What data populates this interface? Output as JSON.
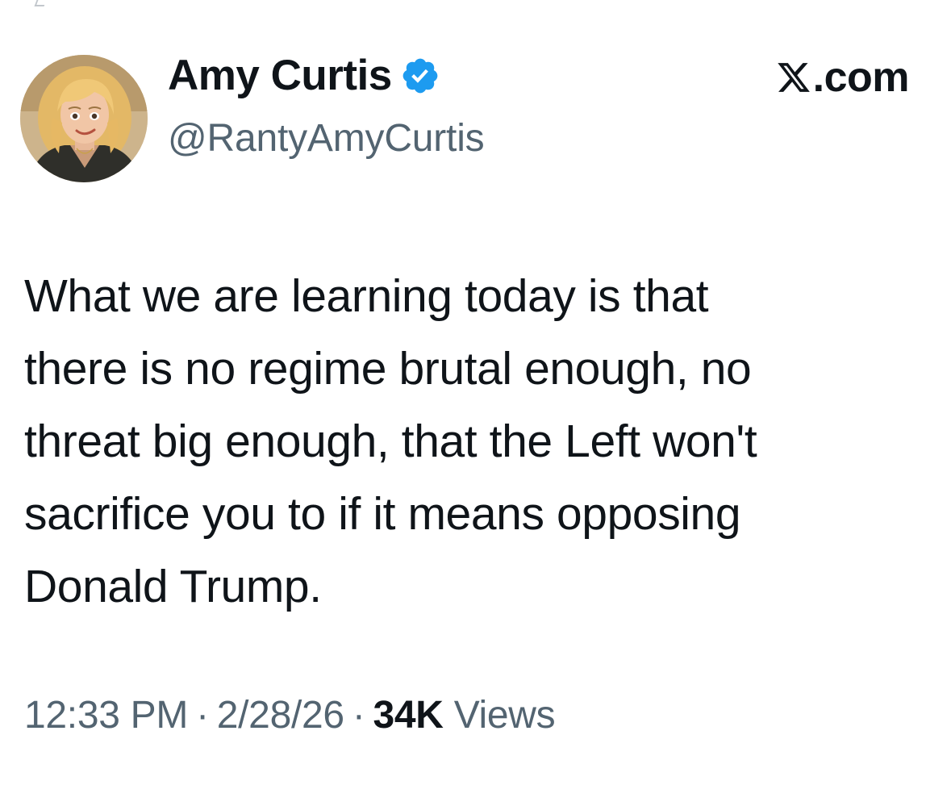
{
  "author": {
    "display_name": "Amy Curtis",
    "handle": "@RantyAmyCurtis",
    "verified": true,
    "verified_color": "#1d9bf0"
  },
  "brand": {
    "text": ".com",
    "icon": "x-logo-icon"
  },
  "tweet": {
    "lines": [
      "What we are learning today is that",
      "there is no regime brutal enough, no",
      "threat big enough, that the Left won't",
      "sacrifice you to if it means opposing",
      "Donald Trump."
    ]
  },
  "meta": {
    "time": "12:33 PM",
    "separator": "·",
    "date": "2/28/26",
    "views_count": "34K",
    "views_label": "Views"
  },
  "colors": {
    "text_primary": "#0f1419",
    "text_secondary": "#536471",
    "background": "#ffffff"
  }
}
